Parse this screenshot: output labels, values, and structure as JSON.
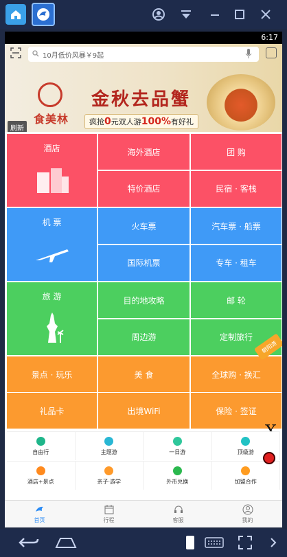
{
  "status": {
    "time": "6:17"
  },
  "search": {
    "placeholder": "10月低价风暴￥9起"
  },
  "banner": {
    "logo_text": "食美林",
    "headline": "金秋去品蟹",
    "sub_pre": "疯抢",
    "sub_zero": "0",
    "sub_mid": "元双人游",
    "sub_percent": "100%",
    "sub_post": "有好礼",
    "refresh_label": "刷新"
  },
  "grid": {
    "hotel": {
      "main": "酒店",
      "items": [
        "海外酒店",
        "团 购",
        "特价酒店",
        "民宿 · 客栈"
      ]
    },
    "flight": {
      "main": "机 票",
      "items": [
        "火车票",
        "汽车票 · 船票",
        "国际机票",
        "专车 · 租车"
      ]
    },
    "travel": {
      "main": "旅 游",
      "items": [
        "目的地攻略",
        "邮 轮",
        "周边游",
        "定制旅行"
      ],
      "ribbon": "朝阳游"
    },
    "more": {
      "items": [
        "景点 · 玩乐",
        "美 食",
        "全球购 · 换汇",
        "礼品卡",
        "出境WiFi",
        "保险 · 签证"
      ]
    }
  },
  "close_label": "X",
  "mini": {
    "row1": [
      "自由行",
      "主题游",
      "一日游",
      "顶级游"
    ],
    "row2": [
      "酒店+景点",
      "亲子·游学",
      "外币兑换",
      "加盟合作"
    ]
  },
  "nav": {
    "items": [
      "首页",
      "行程",
      "客服",
      "我的"
    ]
  },
  "colors": {
    "hotel": "#fc5166",
    "flight": "#3f9af7",
    "travel": "#4ccf5f",
    "more": "#fc9a2f",
    "accent": "#2c8cf5"
  }
}
